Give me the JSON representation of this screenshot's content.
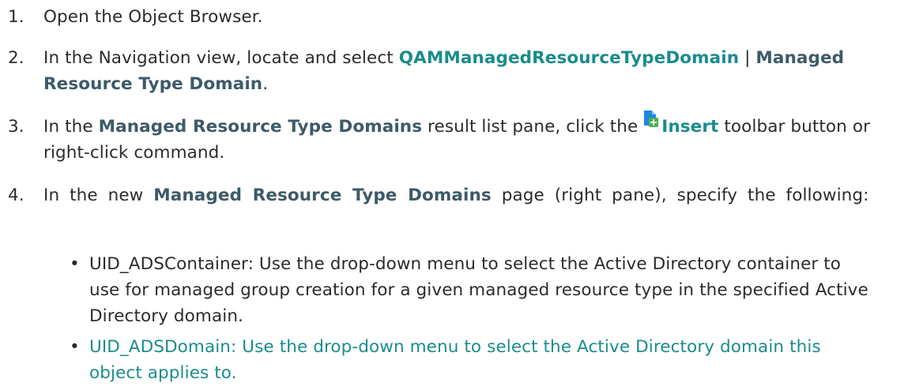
{
  "steps": [
    {
      "number": "1.",
      "text": "Open the Object Browser."
    },
    {
      "number": "2.",
      "pre": "In the Navigation view, locate and select ",
      "bold1": "QAMManagedResourceTypeDomain",
      "sep": " | ",
      "bold2": "Managed Resource Type Domain",
      "post": "."
    },
    {
      "number": "3.",
      "pre": "In the ",
      "bold1": "Managed Resource Type Domains",
      "mid": " result list pane, click the ",
      "icon": "insert-icon",
      "bold2": "Insert",
      "post": " toolbar button or right-click command."
    },
    {
      "number": "4.",
      "pre": "In the new ",
      "bold1": "Managed Resource Type Domains",
      "post": " page (right pane), specify the  following:"
    }
  ],
  "bullets": [
    {
      "bullet": "•",
      "text": "UID_ADSContainer: Use the drop-down menu to select the Active Directory container to use for managed group creation for a given managed resource type in the specified Active Directory domain."
    },
    {
      "bullet": "•",
      "text": "UID_ADSDomain: Use the drop-down menu to select the Active Directory domain this object applies to."
    }
  ],
  "colors": {
    "text": "#2b2b2b",
    "teal": "#1a8c8c",
    "slate": "#3d5a68",
    "icon_blue": "#1e88e5",
    "icon_green": "#4caf50"
  }
}
